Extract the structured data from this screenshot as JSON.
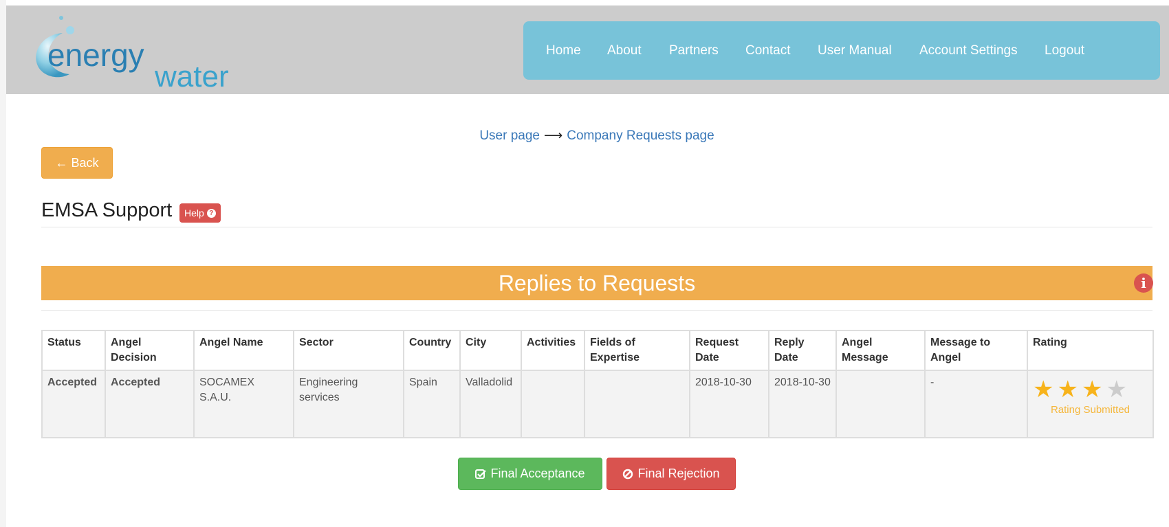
{
  "brand": {
    "word1": "energy",
    "word2": "water"
  },
  "nav": {
    "items": [
      {
        "label": "Home"
      },
      {
        "label": "About"
      },
      {
        "label": "Partners"
      },
      {
        "label": "Contact"
      },
      {
        "label": "User Manual"
      },
      {
        "label": "Account Settings"
      },
      {
        "label": "Logout"
      }
    ]
  },
  "breadcrumb": {
    "first": "User page",
    "separator": "⟶",
    "second": "Company Requests page"
  },
  "back_button": {
    "label": "← Back"
  },
  "page": {
    "title": "EMSA Support",
    "help_label": "Help",
    "help_icon": "?"
  },
  "panel": {
    "title": "Replies to Requests",
    "info_icon": "i"
  },
  "table": {
    "headers": [
      "Status",
      "Angel Decision",
      "Angel Name",
      "Sector",
      "Country",
      "City",
      "Activities",
      "Fields of Expertise",
      "Request Date",
      "Reply Date",
      "Angel Message",
      "Message to Angel",
      "Rating"
    ],
    "rows": [
      {
        "status": "Accepted",
        "angel_decision": "Accepted",
        "angel_name": "SOCAMEX S.A.U.",
        "sector": "Engineering services",
        "country": "Spain",
        "city": "Valladolid",
        "activities": "",
        "fields_of_expertise": "",
        "request_date": "2018-10-30",
        "reply_date": "2018-10-30",
        "angel_message": "",
        "message_to_angel": "-",
        "rating": {
          "value": 3,
          "max": 4,
          "label": "Rating Submitted"
        }
      }
    ]
  },
  "actions": {
    "accept_label": "Final Acceptance",
    "accept_icon": "check-square-icon",
    "reject_label": "Final Rejection",
    "reject_icon": "ban-icon"
  },
  "colors": {
    "nav_bg": "#78c3d9",
    "header_bg": "#cccccc",
    "warning": "#f0ad4e",
    "danger": "#d9534f",
    "success": "#5cb85c",
    "link": "#3a78b8",
    "accepted_text": "#2e8b23",
    "star_on": "#f7b31b",
    "star_off": "#cccccc"
  }
}
